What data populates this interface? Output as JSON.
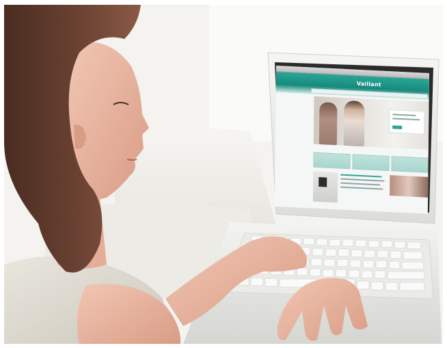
{
  "photo": {
    "description_free": true,
    "screen_site": {
      "logo_text": "Vaillant"
    }
  },
  "colors": {
    "accent_teal": "#1e9a8b",
    "skin": "#e8b9a6",
    "hair": "#5c3a2c",
    "laptop_white": "#f2f2f0",
    "wall": "#f3f2ee"
  }
}
